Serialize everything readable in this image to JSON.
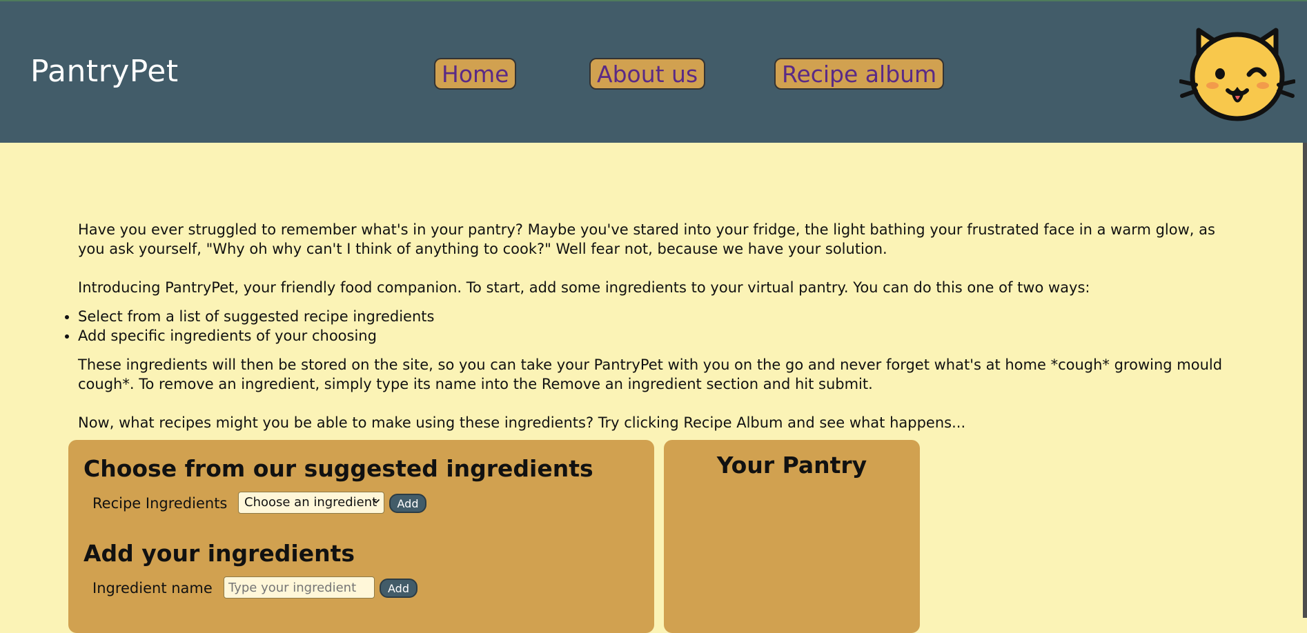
{
  "header": {
    "brand": "PantryPet",
    "nav": {
      "home": "Home",
      "about": "About us",
      "recipes": "Recipe album"
    },
    "logo_icon": "winking-cat-face-icon"
  },
  "main": {
    "paragraphs": {
      "intro_1": "Have you ever struggled to remember what's in your pantry? Maybe you've stared into your fridge, the light bathing your frustrated face in a warm glow, as you ask yourself, \"Why oh why can't I think of anything to cook?\" Well fear not, because we have your solution.",
      "intro_2": "Introducing PantryPet, your friendly food companion. To start, add some ingredients to your virtual pantry. You can do this one of two ways:",
      "storage": "These ingredients will then be stored on the site, so you can take your PantryPet with you on the go and never forget what's at home *cough* growing mould cough*. To remove an ingredient, simply type its name into the Remove an ingredient section and hit submit.",
      "recipes_prompt": "Now, what recipes might you be able to make using these ingredients? Try clicking Recipe Album and see what happens..."
    },
    "methods": [
      "Select from a list of suggested recipe ingredients",
      "Add specific ingredients of your choosing"
    ]
  },
  "suggested_panel": {
    "heading": "Choose from our suggested ingredients",
    "label": "Recipe Ingredients",
    "select_value": "Choose an ingredient",
    "add_button": "Add"
  },
  "add_panel": {
    "heading": "Add your ingredients",
    "label": "Ingredient name",
    "input_placeholder": "Type your ingredient",
    "add_button": "Add"
  },
  "pantry_panel": {
    "heading": "Your Pantry"
  },
  "colors": {
    "header": "#425C69",
    "background": "#FBF3B6",
    "accent": "#D1A150",
    "nav_text": "#5A2A86"
  }
}
